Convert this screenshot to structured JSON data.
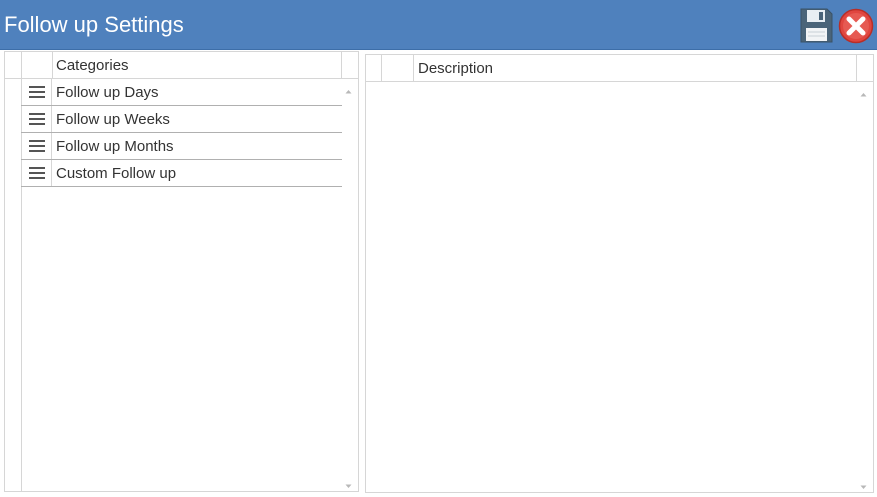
{
  "window": {
    "title": "Follow up Settings"
  },
  "toolbar": {
    "save_icon": "save-floppy-icon",
    "close_icon": "close-x-icon",
    "colors": {
      "header_bg": "#4f81bd",
      "close_red": "#e0463f",
      "floppy": "#4a6479"
    }
  },
  "categories_grid": {
    "header": "Categories",
    "rows": [
      {
        "label": "Follow up Days",
        "handle_icon": "drag-handle-icon"
      },
      {
        "label": "Follow up Weeks",
        "handle_icon": "drag-handle-icon"
      },
      {
        "label": "Follow up Months",
        "handle_icon": "drag-handle-icon"
      },
      {
        "label": "Custom Follow up",
        "handle_icon": "drag-handle-icon"
      }
    ]
  },
  "description_grid": {
    "header": "Description",
    "rows": []
  }
}
